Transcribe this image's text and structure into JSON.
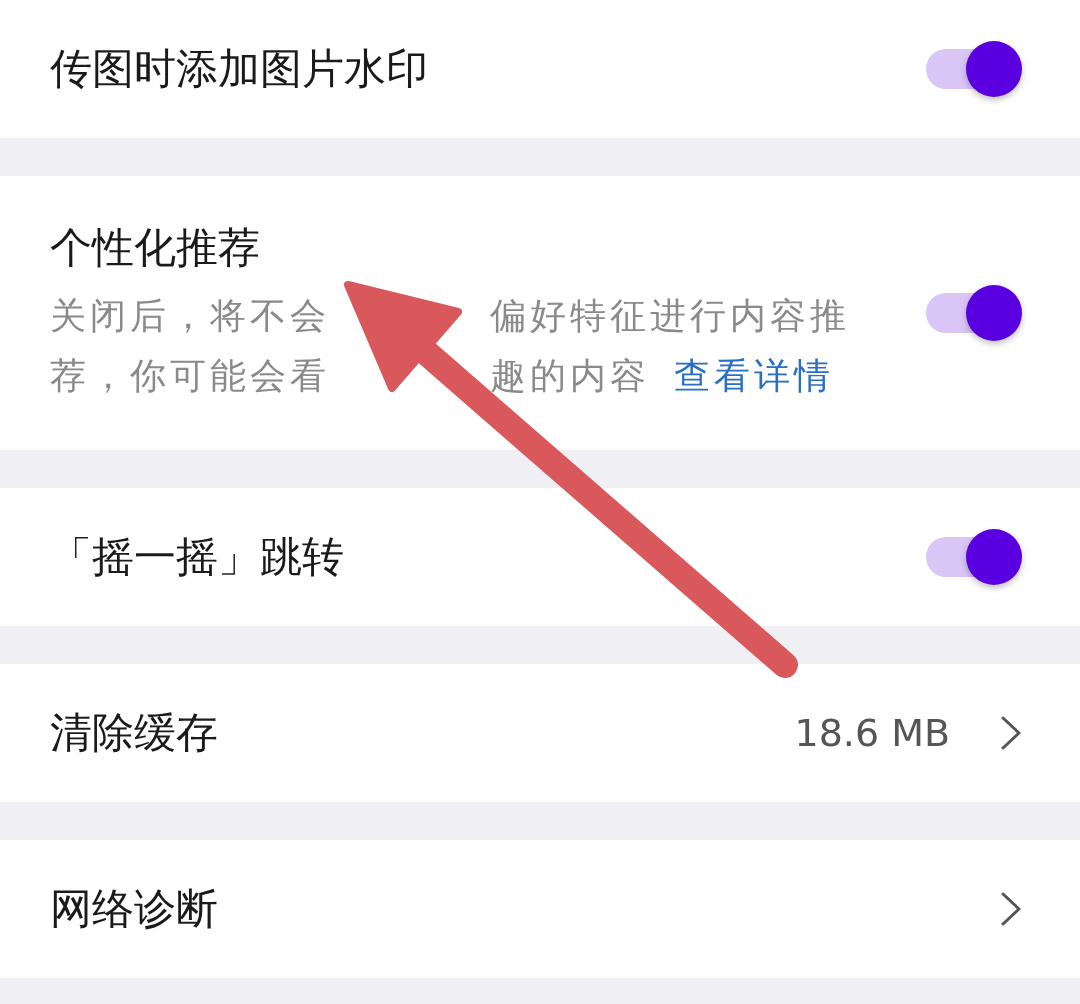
{
  "settings": [
    {
      "kind": "toggle",
      "label": "传图时添加图片水印",
      "on": true
    },
    {
      "kind": "toggle",
      "label": "个性化推荐",
      "description_lines": [
        [
          "关闭后，将不会",
          "偏好特征进行内容推"
        ],
        [
          "荐，你可能会看",
          "趣的内容"
        ]
      ],
      "link": "查看详情",
      "on": true
    },
    {
      "kind": "toggle",
      "label": "「摇一摇」跳转",
      "on": true
    },
    {
      "kind": "nav",
      "label": "清除缓存",
      "value": "18.6 MB"
    },
    {
      "kind": "nav",
      "label": "网络诊断"
    }
  ]
}
